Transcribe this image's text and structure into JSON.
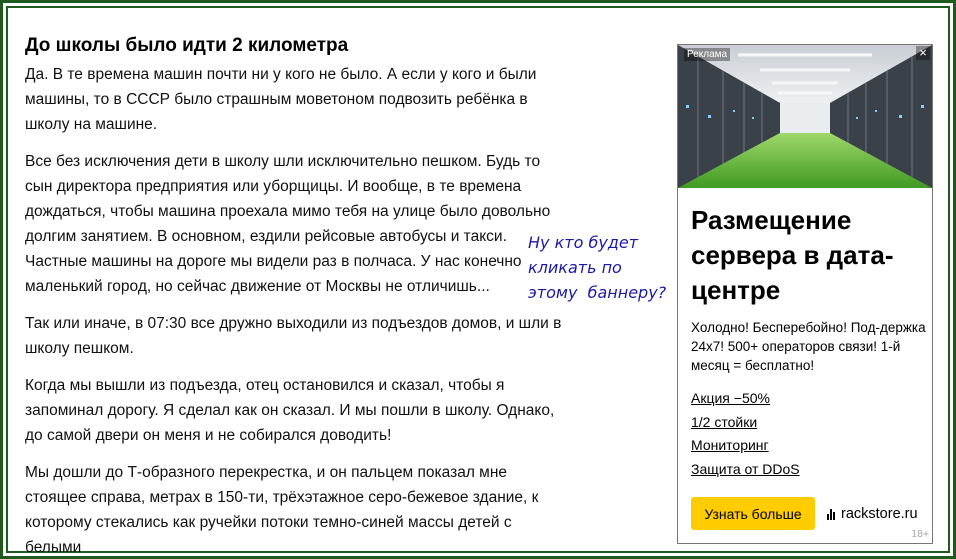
{
  "article": {
    "title": "До школы было идти 2 километра",
    "paragraphs": [
      "Да. В те времена машин почти ни у кого не было. А если у кого и были машины, то в СССР было страшным моветоном подвозить ребёнка в школу на машине.",
      "Все без исключения дети в школу шли исключительно пешком. Будь то сын директора предприятия или уборщицы. И вообще, в те времена дождаться, чтобы машина проехала мимо тебя на улице было довольно долгим занятием. В основном, ездили рейсовые автобусы и такси. Частные машины на дороге мы видели раз в полчаса. У нас конечно маленький город, но сейчас движение от Москвы не отличишь...",
      "Так или иначе, в 07:30 все дружно выходили из подъездов домов, и шли в школу пешком.",
      "Когда мы вышли из подъезда, отец остановился и сказал, чтобы я запоминал дорогу. Я сделал как он сказал. И мы пошли в школу. Однако, до самой двери он меня и не собирался доводить!",
      "Мы дошли до Т-образного перекрестка, и он пальцем показал мне стоящее справа, метрах в 150-ти, трёхэтажное серо-бежевое здание, к которому стекались как ручейки потоки темно-синей массы детей с белыми"
    ]
  },
  "annotation": {
    "lines": [
      "Ну кто будет",
      "кликать по",
      "этому  баннеру?"
    ],
    "color": "#1a1aa8"
  },
  "ad": {
    "label": "Реклама",
    "close_icon": "close-icon",
    "title": "Размещение сервера в дата-центре",
    "description": "Холодно! Бесперебойно! Под-держка 24x7! 500+ операторов связи! 1-й месяц = бесплатно!",
    "links": [
      "Акция −50%",
      "1/2 стойки",
      "Мониторинг",
      "Защита от DDoS"
    ],
    "button_label": "Узнать больше",
    "domain": "rackstore.ru",
    "age_rating": "18+",
    "button_color": "#ffcc00"
  },
  "frame_color": "#1f5a1f"
}
